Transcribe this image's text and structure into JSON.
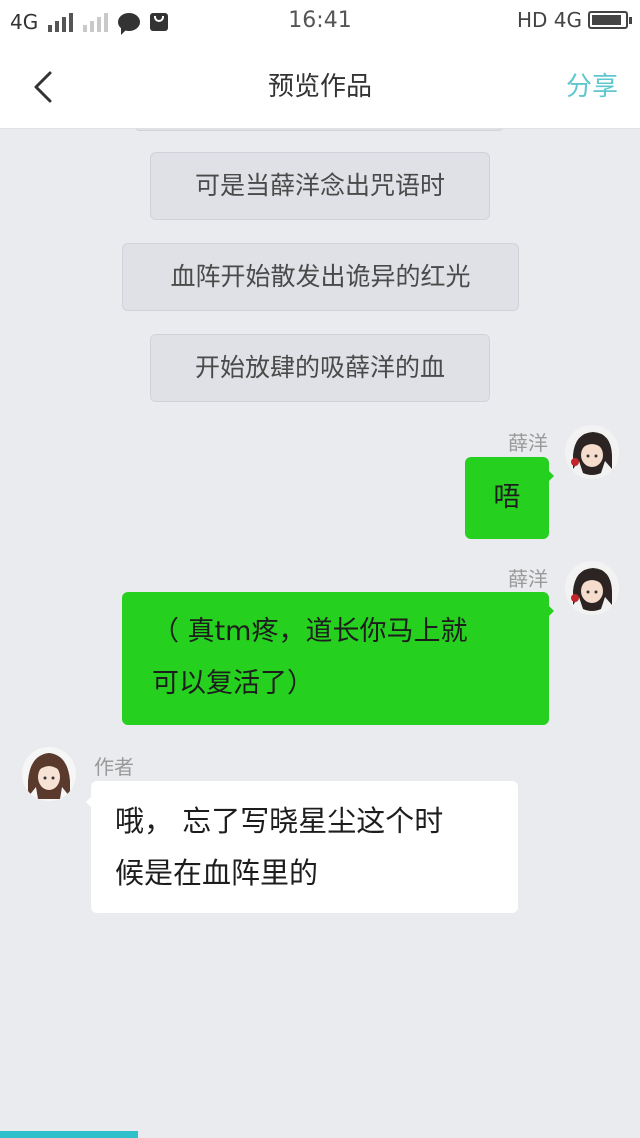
{
  "status_bar": {
    "network_left": "4G",
    "time": "16:41",
    "network_right": "HD 4G",
    "battery_level": 0.9
  },
  "nav": {
    "title": "预览作品",
    "share_label": "分享",
    "back_icon": "chevron-left-icon"
  },
  "narration": [
    "可是当薛洋念出咒语时",
    "血阵开始散发出诡异的红光",
    "开始放肆的吸薛洋的血"
  ],
  "messages": [
    {
      "sender": "薛洋",
      "side": "right",
      "lines": [
        "唔"
      ]
    },
    {
      "sender": "薛洋",
      "side": "right",
      "lines": [
        "（ 真tm疼，道长你马上就",
        "可以复活了）"
      ]
    },
    {
      "sender": "作者",
      "side": "left",
      "lines": [
        "哦，  忘了写晓星尘这个时",
        "候是在血阵里的"
      ]
    }
  ],
  "colors": {
    "accent": "#5fc7cf",
    "bubble_green": "#25d01f",
    "chat_background": "#e9ebef"
  }
}
